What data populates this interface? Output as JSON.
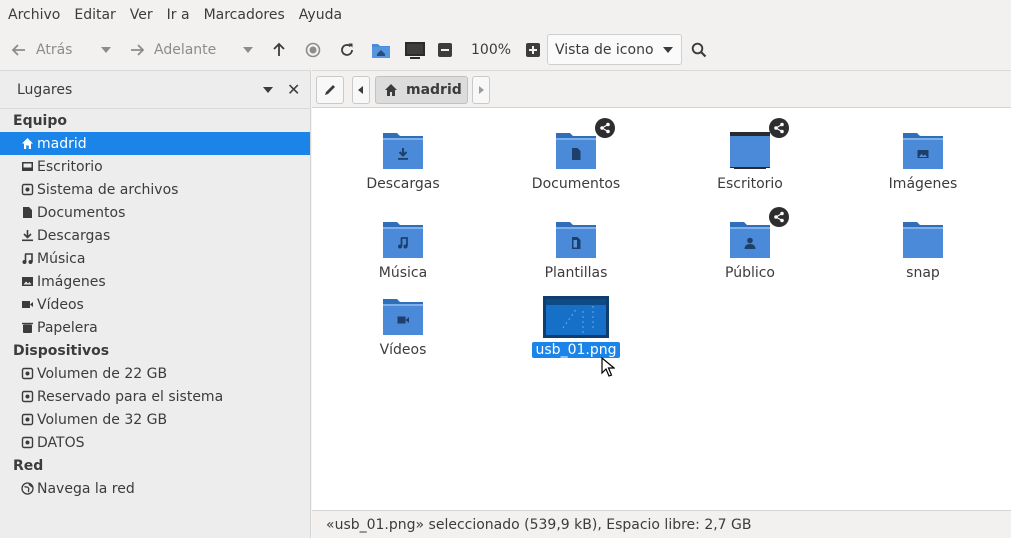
{
  "menu": [
    "Archivo",
    "Editar",
    "Ver",
    "Ir a",
    "Marcadores",
    "Ayuda"
  ],
  "toolbar": {
    "back_label": "Atrás",
    "forward_label": "Adelante",
    "zoom": "100%",
    "view_mode": "Vista de icono"
  },
  "sidebar": {
    "title": "Lugares",
    "sections": [
      {
        "title": "Equipo",
        "items": [
          {
            "label": "madrid",
            "icon": "home-icon",
            "selected": true
          },
          {
            "label": "Escritorio",
            "icon": "desktop-icon"
          },
          {
            "label": "Sistema de archivos",
            "icon": "drive-icon"
          },
          {
            "label": "Documentos",
            "icon": "document-icon"
          },
          {
            "label": "Descargas",
            "icon": "download-icon"
          },
          {
            "label": "Música",
            "icon": "music-icon"
          },
          {
            "label": "Imágenes",
            "icon": "image-icon"
          },
          {
            "label": "Vídeos",
            "icon": "video-icon"
          },
          {
            "label": "Papelera",
            "icon": "trash-icon"
          }
        ]
      },
      {
        "title": "Dispositivos",
        "items": [
          {
            "label": "Volumen de 22 GB",
            "icon": "drive-icon"
          },
          {
            "label": "Reservado para el sistema",
            "icon": "drive-icon"
          },
          {
            "label": "Volumen de 32 GB",
            "icon": "drive-icon"
          },
          {
            "label": "DATOS",
            "icon": "drive-icon"
          }
        ]
      },
      {
        "title": "Red",
        "items": [
          {
            "label": "Navega la red",
            "icon": "network-icon"
          }
        ]
      }
    ]
  },
  "path": {
    "current": "madrid"
  },
  "files": [
    {
      "label": "Descargas",
      "emblem": "download-icon",
      "shared": false
    },
    {
      "label": "Documentos",
      "emblem": "document-icon",
      "shared": true
    },
    {
      "label": "Escritorio",
      "emblem": "desktop-icon",
      "shared": true
    },
    {
      "label": "Imágenes",
      "emblem": "image-icon",
      "shared": false
    },
    {
      "label": "Música",
      "emblem": "music-icon",
      "shared": false
    },
    {
      "label": "Plantillas",
      "emblem": "template-icon",
      "shared": false
    },
    {
      "label": "Público",
      "emblem": "user-icon",
      "shared": true
    },
    {
      "label": "snap",
      "emblem": "",
      "shared": false
    },
    {
      "label": "Vídeos",
      "emblem": "video-icon",
      "shared": false
    },
    {
      "label": "usb_01.png",
      "emblem": "image-thumbnail",
      "shared": false,
      "selected": true
    }
  ],
  "status": "«usb_01.png» seleccionado (539,9 kB), Espacio libre: 2,7 GB",
  "colors": {
    "accent": "#1b84e8",
    "folder": "#4a8ad8",
    "folder_dark": "#2f6fba"
  }
}
